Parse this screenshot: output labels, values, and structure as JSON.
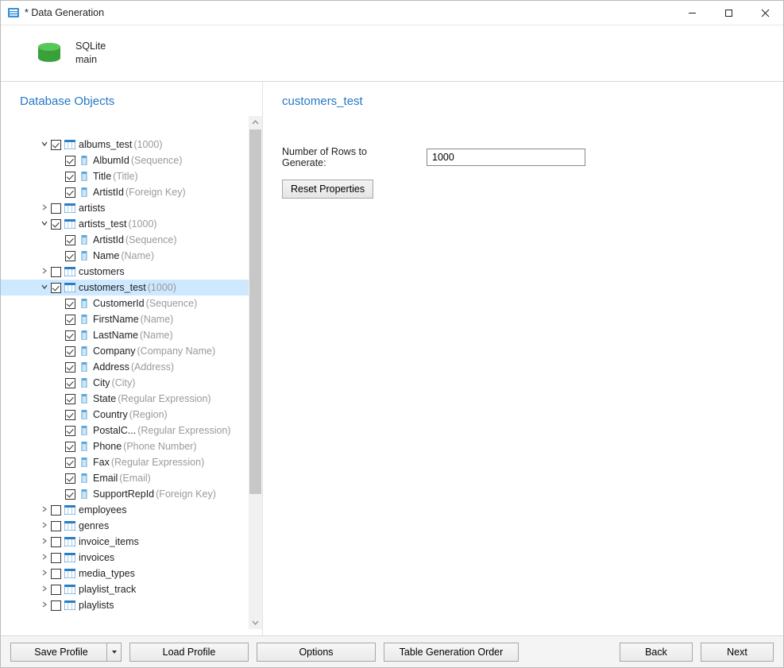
{
  "window": {
    "title": "* Data Generation"
  },
  "header": {
    "db_engine": "SQLite",
    "db_name": "main"
  },
  "left": {
    "title": "Database Objects"
  },
  "right": {
    "title": "customers_test",
    "rows_label": "Number of Rows to Generate:",
    "rows_value": "1000",
    "reset_btn": "Reset Properties"
  },
  "footer": {
    "save_profile": "Save Profile",
    "load_profile": "Load Profile",
    "options": "Options",
    "order": "Table Generation Order",
    "back": "Back",
    "next": "Next"
  },
  "tree": [
    {
      "depth": 0,
      "expander": "down",
      "checked": true,
      "icon": "table",
      "label": "albums_test",
      "hint": "(1000)"
    },
    {
      "depth": 1,
      "expander": "none",
      "checked": true,
      "icon": "column",
      "label": "AlbumId",
      "hint": "(Sequence)"
    },
    {
      "depth": 1,
      "expander": "none",
      "checked": true,
      "icon": "column",
      "label": "Title",
      "hint": "(Title)"
    },
    {
      "depth": 1,
      "expander": "none",
      "checked": true,
      "icon": "column",
      "label": "ArtistId",
      "hint": "(Foreign Key)"
    },
    {
      "depth": 0,
      "expander": "right",
      "checked": false,
      "icon": "table",
      "label": "artists",
      "hint": ""
    },
    {
      "depth": 0,
      "expander": "down",
      "checked": true,
      "icon": "table",
      "label": "artists_test",
      "hint": "(1000)"
    },
    {
      "depth": 1,
      "expander": "none",
      "checked": true,
      "icon": "column",
      "label": "ArtistId",
      "hint": "(Sequence)"
    },
    {
      "depth": 1,
      "expander": "none",
      "checked": true,
      "icon": "column",
      "label": "Name",
      "hint": "(Name)"
    },
    {
      "depth": 0,
      "expander": "right",
      "checked": false,
      "icon": "table",
      "label": "customers",
      "hint": ""
    },
    {
      "depth": 0,
      "expander": "down",
      "checked": true,
      "icon": "table",
      "label": "customers_test",
      "hint": "(1000)",
      "selected": true
    },
    {
      "depth": 1,
      "expander": "none",
      "checked": true,
      "icon": "column",
      "label": "CustomerId",
      "hint": "(Sequence)"
    },
    {
      "depth": 1,
      "expander": "none",
      "checked": true,
      "icon": "column",
      "label": "FirstName",
      "hint": "(Name)"
    },
    {
      "depth": 1,
      "expander": "none",
      "checked": true,
      "icon": "column",
      "label": "LastName",
      "hint": "(Name)"
    },
    {
      "depth": 1,
      "expander": "none",
      "checked": true,
      "icon": "column",
      "label": "Company",
      "hint": "(Company Name)"
    },
    {
      "depth": 1,
      "expander": "none",
      "checked": true,
      "icon": "column",
      "label": "Address",
      "hint": "(Address)"
    },
    {
      "depth": 1,
      "expander": "none",
      "checked": true,
      "icon": "column",
      "label": "City",
      "hint": "(City)"
    },
    {
      "depth": 1,
      "expander": "none",
      "checked": true,
      "icon": "column",
      "label": "State",
      "hint": "(Regular Expression)"
    },
    {
      "depth": 1,
      "expander": "none",
      "checked": true,
      "icon": "column",
      "label": "Country",
      "hint": "(Region)"
    },
    {
      "depth": 1,
      "expander": "none",
      "checked": true,
      "icon": "column",
      "label": "PostalC...",
      "hint": "(Regular Expression)"
    },
    {
      "depth": 1,
      "expander": "none",
      "checked": true,
      "icon": "column",
      "label": "Phone",
      "hint": "(Phone Number)"
    },
    {
      "depth": 1,
      "expander": "none",
      "checked": true,
      "icon": "column",
      "label": "Fax",
      "hint": "(Regular Expression)"
    },
    {
      "depth": 1,
      "expander": "none",
      "checked": true,
      "icon": "column",
      "label": "Email",
      "hint": "(Email)"
    },
    {
      "depth": 1,
      "expander": "none",
      "checked": true,
      "icon": "column",
      "label": "SupportRepId",
      "hint": "(Foreign Key)"
    },
    {
      "depth": 0,
      "expander": "right",
      "checked": false,
      "icon": "table",
      "label": "employees",
      "hint": ""
    },
    {
      "depth": 0,
      "expander": "right",
      "checked": false,
      "icon": "table",
      "label": "genres",
      "hint": ""
    },
    {
      "depth": 0,
      "expander": "right",
      "checked": false,
      "icon": "table",
      "label": "invoice_items",
      "hint": ""
    },
    {
      "depth": 0,
      "expander": "right",
      "checked": false,
      "icon": "table",
      "label": "invoices",
      "hint": ""
    },
    {
      "depth": 0,
      "expander": "right",
      "checked": false,
      "icon": "table",
      "label": "media_types",
      "hint": ""
    },
    {
      "depth": 0,
      "expander": "right",
      "checked": false,
      "icon": "table",
      "label": "playlist_track",
      "hint": ""
    },
    {
      "depth": 0,
      "expander": "right",
      "checked": false,
      "icon": "table",
      "label": "playlists",
      "hint": ""
    }
  ]
}
